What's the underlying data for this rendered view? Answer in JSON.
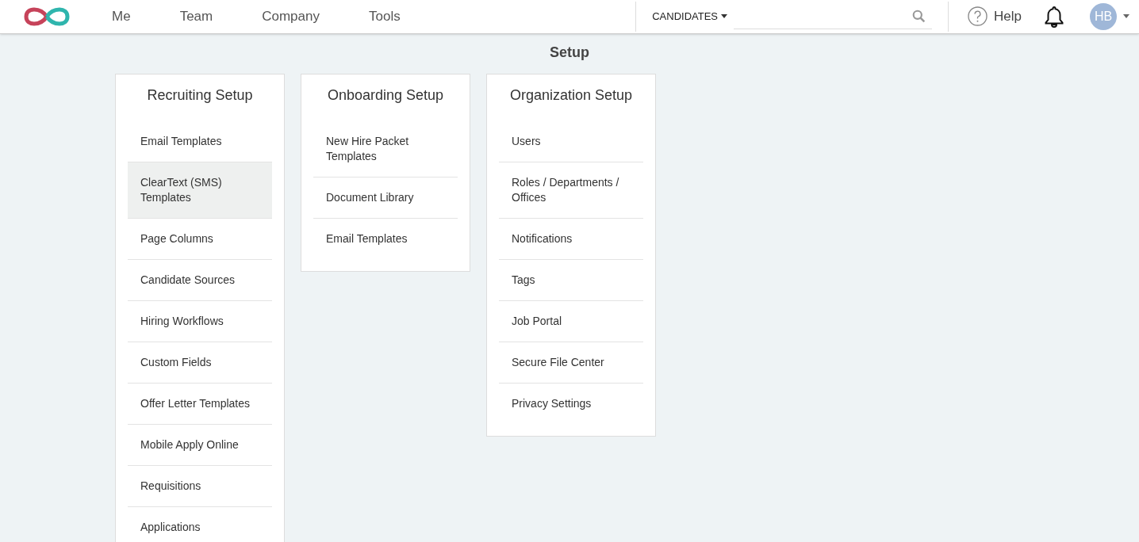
{
  "nav": {
    "items": [
      {
        "label": "Me"
      },
      {
        "label": "Team"
      },
      {
        "label": "Company"
      },
      {
        "label": "Tools"
      }
    ]
  },
  "search": {
    "scope": "CANDIDATES"
  },
  "help": {
    "label": "Help"
  },
  "user": {
    "initials": "HB"
  },
  "page_title": "Setup",
  "cards": [
    {
      "title": "Recruiting Setup",
      "items": [
        {
          "label": "Email Templates",
          "selected": false
        },
        {
          "label": "ClearText (SMS) Templates",
          "selected": true
        },
        {
          "label": "Page Columns",
          "selected": false
        },
        {
          "label": "Candidate Sources",
          "selected": false
        },
        {
          "label": "Hiring Workflows",
          "selected": false
        },
        {
          "label": "Custom Fields",
          "selected": false
        },
        {
          "label": "Offer Letter Templates",
          "selected": false
        },
        {
          "label": "Mobile Apply Online",
          "selected": false
        },
        {
          "label": "Requisitions",
          "selected": false
        },
        {
          "label": "Applications",
          "selected": false
        }
      ]
    },
    {
      "title": "Onboarding Setup",
      "items": [
        {
          "label": "New Hire Packet Templates",
          "selected": false
        },
        {
          "label": "Document Library",
          "selected": false
        },
        {
          "label": "Email Templates",
          "selected": false
        }
      ]
    },
    {
      "title": "Organization Setup",
      "items": [
        {
          "label": "Users",
          "selected": false
        },
        {
          "label": "Roles / Departments / Offices",
          "selected": false
        },
        {
          "label": "Notifications",
          "selected": false
        },
        {
          "label": "Tags",
          "selected": false
        },
        {
          "label": "Job Portal",
          "selected": false
        },
        {
          "label": "Secure File Center",
          "selected": false
        },
        {
          "label": "Privacy Settings",
          "selected": false
        }
      ]
    }
  ]
}
